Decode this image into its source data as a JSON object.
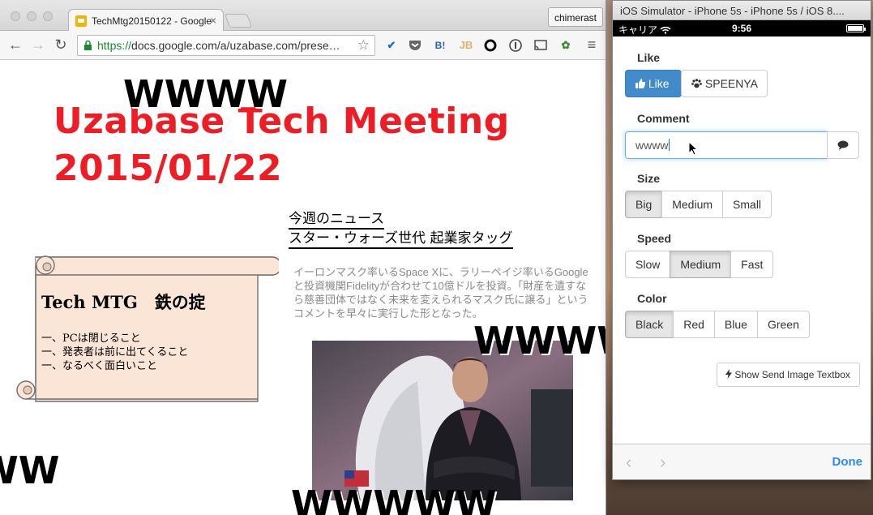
{
  "browser": {
    "tab_title": "TechMtg20150122 - Google",
    "tab_close": "×",
    "profile_name": "chimerast",
    "url_protocol": "https://",
    "url_rest": "docs.google.com/a/uzabase.com/prese…",
    "nav": {
      "back": "←",
      "forward": "→",
      "reload": "↻",
      "menu": "≡",
      "bookmark": "☆"
    }
  },
  "slide": {
    "overlay_wwww_1": "WWWW",
    "overlay_wwww_2": "WWWWW",
    "overlay_wwww_3": "WW",
    "overlay_wwww_4": "WWWWW",
    "title_line1": "Uzabase Tech Meeting",
    "title_line2": "2015/01/22",
    "news_heading": "今週のニュース",
    "news_headline": "スター・ウォーズ世代 起業家タッグ",
    "news_body": "イーロンマスク率いるSpace Xに、ラリーペイジ率いるGoogleと投資機関Fidelityが合わせて10億ドルを投資。「財産を遺すなら慈善団体ではなく未来を変えられるマスク氏に譲る」というコメントを早々に実行した形となった。",
    "scroll_title": "Tech MTG　鉄の掟",
    "scroll_rules": [
      "一、PCは閉じること",
      "一、発表者は前に出てくること",
      "一、なるべく面白いこと"
    ]
  },
  "simulator": {
    "window_title": "iOS Simulator - iPhone 5s - iPhone 5s / iOS 8....",
    "carrier": "キャリア",
    "time": "9:56",
    "like_label": "Like",
    "like_button": "Like",
    "speenya_button": "SPEENYA",
    "comment_label": "Comment",
    "comment_value": "wwww",
    "size_label": "Size",
    "size_options": [
      "Big",
      "Medium",
      "Small"
    ],
    "size_selected": "Big",
    "speed_label": "Speed",
    "speed_options": [
      "Slow",
      "Medium",
      "Fast"
    ],
    "speed_selected": "Medium",
    "color_label": "Color",
    "color_options": [
      "Black",
      "Red",
      "Blue",
      "Green"
    ],
    "color_selected": "Black",
    "send_image_button": "Show Send Image Textbox",
    "done_button": "Done",
    "prev": "‹",
    "next": "›"
  },
  "colors": {
    "title_red": "#ee1c25",
    "like_blue": "#428bca",
    "ios_blue": "#2d8ee6",
    "scroll_fill": "#fbe5d6",
    "url_green": "#1a8a2a"
  }
}
